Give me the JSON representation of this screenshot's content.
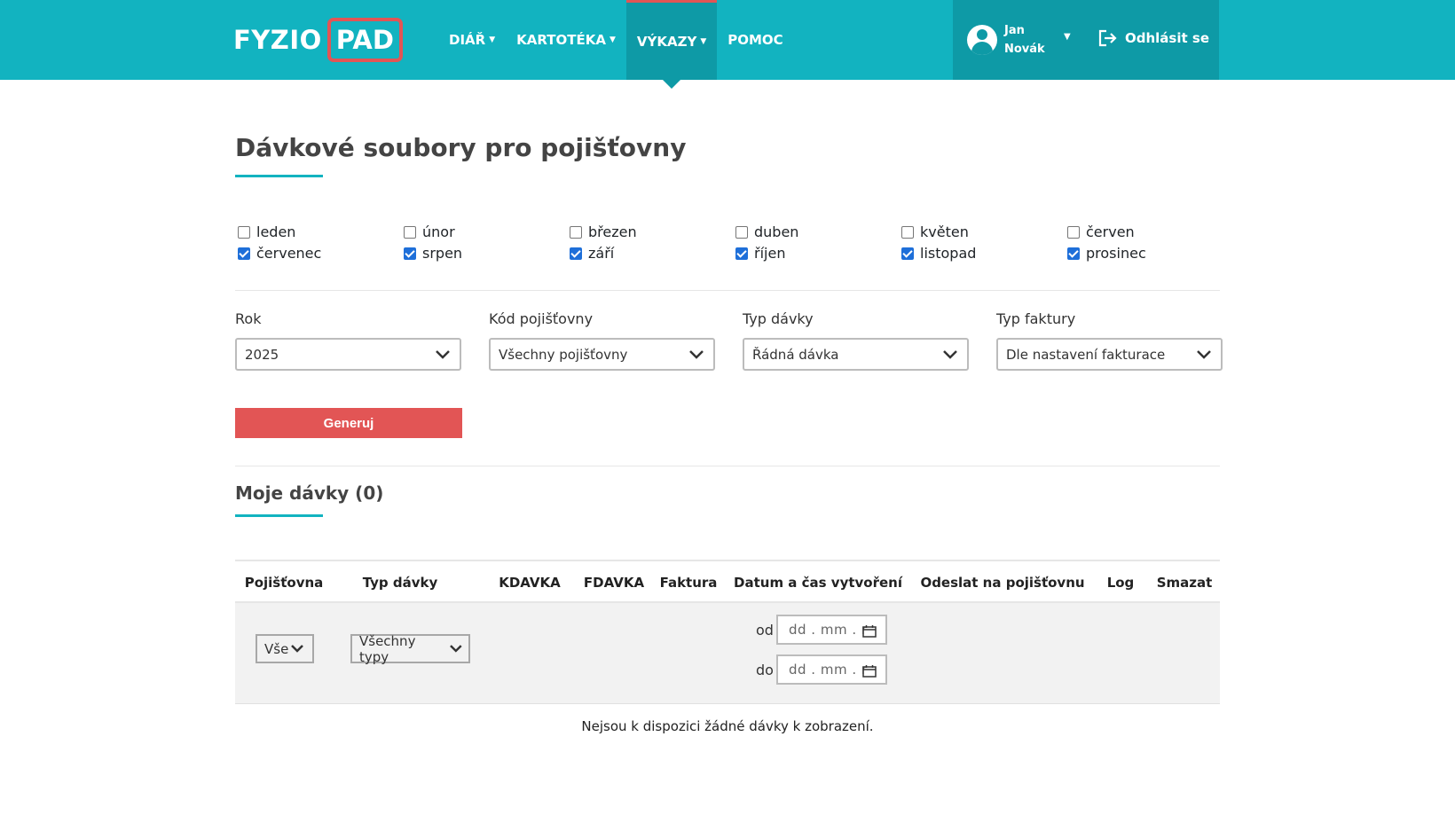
{
  "logo": {
    "part1": "FYZIO",
    "part2": "PAD"
  },
  "nav": [
    {
      "label": "DIÁŘ",
      "caret": true
    },
    {
      "label": "KARTOTÉKA",
      "caret": true
    },
    {
      "label": "VÝKAZY",
      "caret": true,
      "active": true
    },
    {
      "label": "POMOC",
      "caret": false
    }
  ],
  "user": {
    "first_name": "Jan",
    "last_name": "Novák",
    "logout_label": "Odhlásit se"
  },
  "page": {
    "title": "Dávkové soubory pro pojišťovny"
  },
  "months": [
    {
      "label": "leden",
      "checked": false
    },
    {
      "label": "únor",
      "checked": false
    },
    {
      "label": "březen",
      "checked": false
    },
    {
      "label": "duben",
      "checked": false
    },
    {
      "label": "květen",
      "checked": false
    },
    {
      "label": "červen",
      "checked": false
    },
    {
      "label": "červenec",
      "checked": true
    },
    {
      "label": "srpen",
      "checked": true
    },
    {
      "label": "září",
      "checked": true
    },
    {
      "label": "říjen",
      "checked": true
    },
    {
      "label": "listopad",
      "checked": true
    },
    {
      "label": "prosinec",
      "checked": true
    }
  ],
  "filters": {
    "year": {
      "label": "Rok",
      "value": "2025"
    },
    "insurer": {
      "label": "Kód pojišťovny",
      "value": "Všechny pojišťovny"
    },
    "batch_type": {
      "label": "Typ dávky",
      "value": "Řádná dávka"
    },
    "invoice_type": {
      "label": "Typ faktury",
      "value": "Dle nastavení fakturace"
    }
  },
  "generate_label": "Generuj",
  "batches": {
    "title": "Moje dávky (0)",
    "columns": [
      "Pojišťovna",
      "Typ dávky",
      "KDAVKA",
      "FDAVKA",
      "Faktura",
      "Datum a čas vytvoření",
      "Odeslat na pojišťovnu",
      "Log",
      "Smazat"
    ],
    "filter_insurer": "Vše",
    "filter_type": "Všechny typy",
    "date_from_label": "od",
    "date_to_label": "do",
    "date_placeholder": "dd . mm . r",
    "empty_message": "Nejsou k dispozici žádné dávky k zobrazení."
  },
  "colors": {
    "primary": "#12b3c0",
    "primary_dark": "#0e9aa6",
    "accent": "#e25555",
    "checkbox": "#1e6fd9"
  }
}
